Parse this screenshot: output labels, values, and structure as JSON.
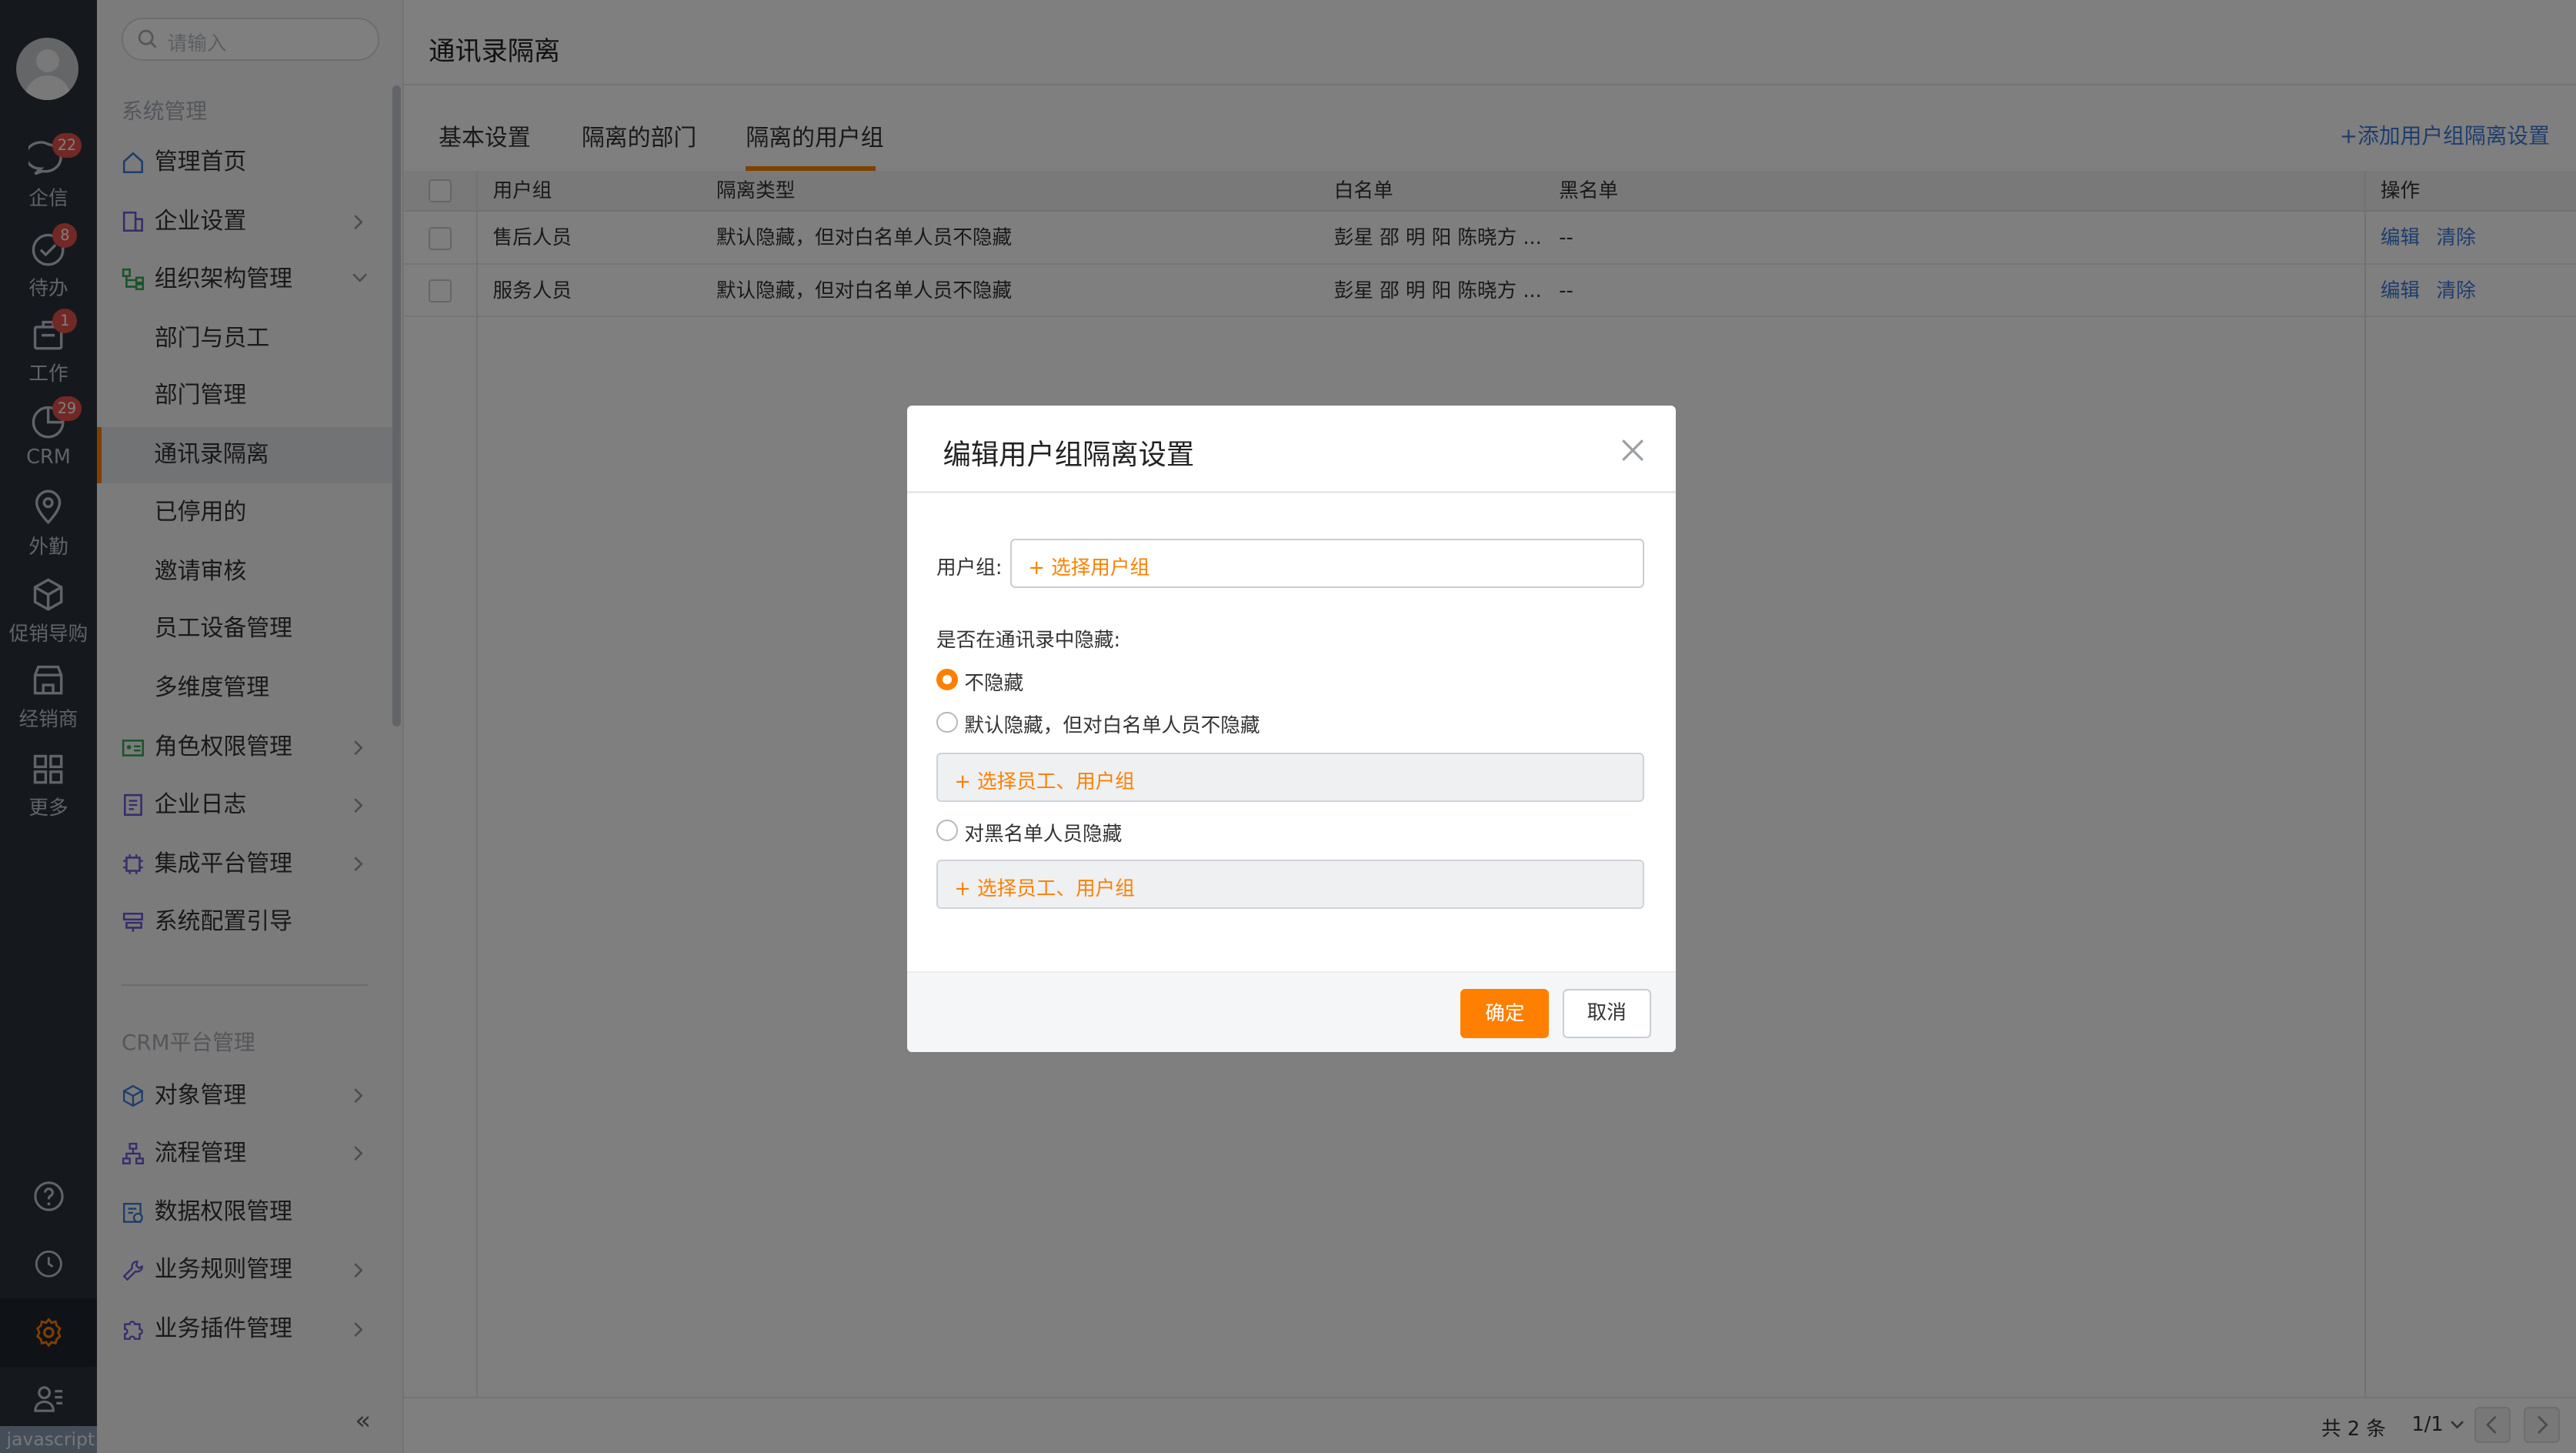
{
  "rail": {
    "items": [
      {
        "label": "企信",
        "icon": "chat-icon",
        "badge": "22"
      },
      {
        "label": "待办",
        "icon": "todo-check-icon",
        "badge": "8"
      },
      {
        "label": "工作",
        "icon": "work-folder-icon",
        "badge": "1"
      },
      {
        "label": "CRM",
        "icon": "crm-chart-icon",
        "badge": "29"
      },
      {
        "label": "外勤",
        "icon": "location-pin-icon",
        "badge": ""
      },
      {
        "label": "促销导购",
        "icon": "box-icon",
        "badge": ""
      },
      {
        "label": "经销商",
        "icon": "store-icon",
        "badge": ""
      },
      {
        "label": "更多",
        "icon": "grid-icon",
        "badge": ""
      }
    ],
    "bottom": [
      "help-icon",
      "clock-icon",
      "settings-gear-icon",
      "contacts-icon"
    ],
    "status_tip": "javascript:;",
    "accent": "#ff8000"
  },
  "side": {
    "search_placeholder": "请输入",
    "section_system": "系统管理",
    "section_crm": "CRM平台管理",
    "items": [
      {
        "label": "管理首页"
      },
      {
        "label": "企业设置"
      },
      {
        "label": "组织架构管理"
      },
      {
        "label": "部门与员工"
      },
      {
        "label": "部门管理"
      },
      {
        "label": "通讯录隔离"
      },
      {
        "label": "已停用的"
      },
      {
        "label": "邀请审核"
      },
      {
        "label": "员工设备管理"
      },
      {
        "label": "多维度管理"
      },
      {
        "label": "角色权限管理"
      },
      {
        "label": "企业日志"
      },
      {
        "label": "集成平台管理"
      },
      {
        "label": "系统配置引导"
      }
    ],
    "crm_items": [
      {
        "label": "对象管理"
      },
      {
        "label": "流程管理"
      },
      {
        "label": "数据权限管理"
      },
      {
        "label": "业务规则管理"
      },
      {
        "label": "业务插件管理"
      }
    ],
    "collapse": "«"
  },
  "main": {
    "title": "通讯录隔离",
    "tabs": [
      "基本设置",
      "隔离的部门",
      "隔离的用户组"
    ],
    "add_link": "+添加用户组隔离设置",
    "table": {
      "headers": [
        "用户组",
        "隔离类型",
        "白名单",
        "黑名单",
        "操作"
      ],
      "rows": [
        {
          "group": "售后人员",
          "type": "默认隐藏，但对白名单人员不隐藏",
          "whitelist": "彭星 邵 明 阳 陈晓方 ...",
          "blacklist": "--",
          "edit": "编辑",
          "clear": "清除"
        },
        {
          "group": "服务人员",
          "type": "默认隐藏，但对白名单人员不隐藏",
          "whitelist": "彭星 邵 明 阳 陈晓方 ...",
          "blacklist": "--",
          "edit": "编辑",
          "clear": "清除"
        }
      ]
    },
    "footer": {
      "total": "共 2 条",
      "page": "1/1"
    }
  },
  "dialog": {
    "title": "编辑用户组隔离设置",
    "group_label": "用户组:",
    "group_picker": "+ 选择用户组",
    "hide_question": "是否在通讯录中隐藏:",
    "options": [
      "不隐藏",
      "默认隐藏，但对白名单人员不隐藏",
      "对黑名单人员隐藏"
    ],
    "selected_option": 0,
    "whitelist_picker": "+ 选择员工、用户组",
    "blacklist_picker": "+ 选择员工、用户组",
    "ok": "确定",
    "cancel": "取消"
  }
}
